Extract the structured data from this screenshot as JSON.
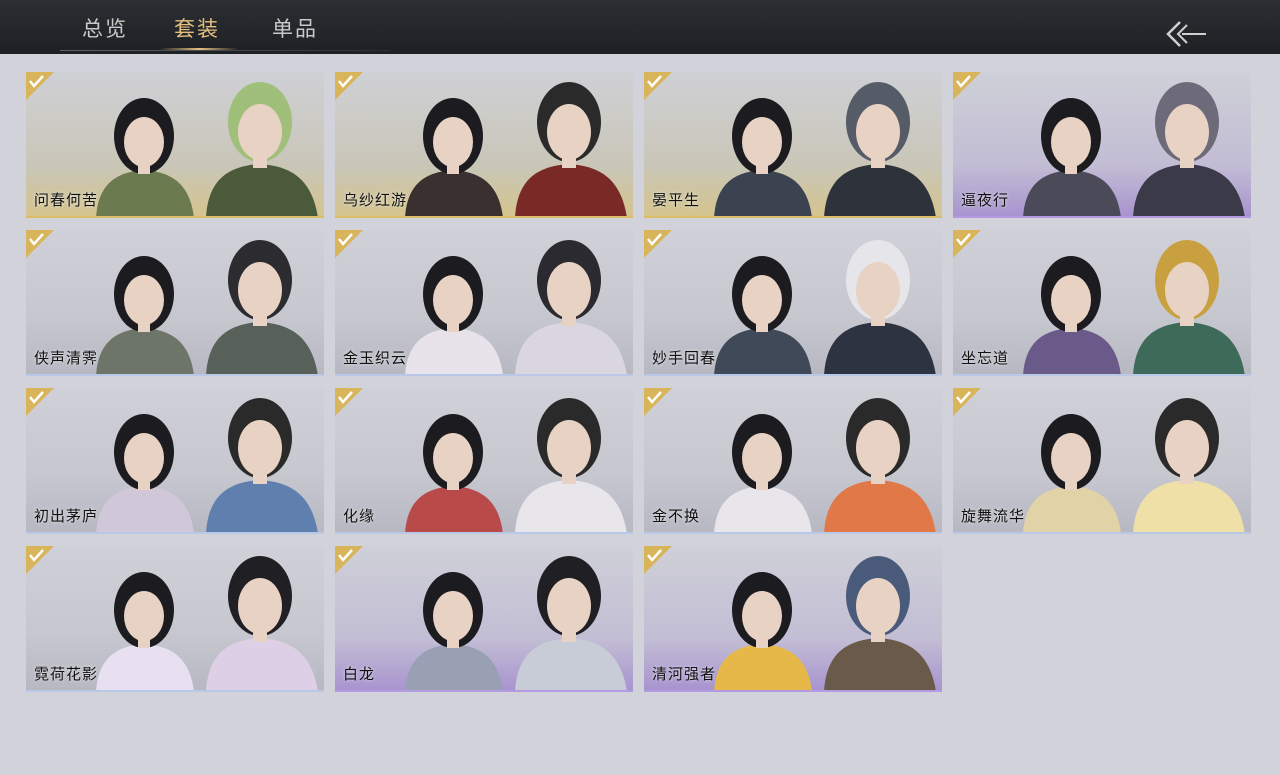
{
  "tabs": [
    {
      "label": "总览"
    },
    {
      "label": "套装"
    },
    {
      "label": "单品"
    }
  ],
  "active_tab": "套装",
  "back_button_icon": "back-arrow-icon",
  "outfits": [
    {
      "name": "问春何苦",
      "owned": true,
      "rarity": "gold"
    },
    {
      "name": "乌纱红游",
      "owned": true,
      "rarity": "gold"
    },
    {
      "name": "晏平生",
      "owned": true,
      "rarity": "gold"
    },
    {
      "name": "逼夜行",
      "owned": true,
      "rarity": "purple"
    },
    {
      "name": "侠声清霁",
      "owned": true,
      "rarity": "blue"
    },
    {
      "name": "金玉织云",
      "owned": true,
      "rarity": "blue"
    },
    {
      "name": "妙手回春",
      "owned": true,
      "rarity": "blue"
    },
    {
      "name": "坐忘道",
      "owned": true,
      "rarity": "blue"
    },
    {
      "name": "初出茅庐",
      "owned": true,
      "rarity": "blue"
    },
    {
      "name": "化缘",
      "owned": true,
      "rarity": "blue"
    },
    {
      "name": "金不换",
      "owned": true,
      "rarity": "blue"
    },
    {
      "name": "旋舞流华",
      "owned": true,
      "rarity": "blue"
    },
    {
      "name": "霓荷花影",
      "owned": true,
      "rarity": "blue"
    },
    {
      "name": "白龙",
      "owned": true,
      "rarity": "purple"
    },
    {
      "name": "清河强者",
      "owned": true,
      "rarity": "purple"
    }
  ],
  "colors": {
    "topbar": "#22262a",
    "active_tab": "#e5c080",
    "inactive_tab": "#c9c9c9",
    "check_badge": "#d8b45a",
    "background": "#d2d2da"
  }
}
